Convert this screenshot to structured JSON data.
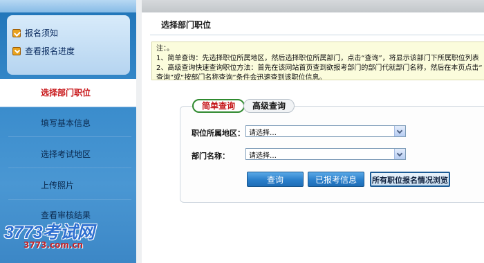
{
  "sidebar": {
    "top_links": [
      {
        "label": "报名须知",
        "icon": "check-icon"
      },
      {
        "label": "查看报名进度",
        "icon": "download-icon"
      }
    ],
    "nav_items": [
      {
        "label": "选择部门职位",
        "active": true
      },
      {
        "label": "填写基本信息",
        "active": false
      },
      {
        "label": "选择考试地区",
        "active": false
      },
      {
        "label": "上传照片",
        "active": false
      },
      {
        "label": "查看审核结果",
        "active": false
      }
    ]
  },
  "watermark": {
    "logo_text": "3773考试网",
    "url": "3773.com.cn"
  },
  "main": {
    "title": "选择部门职位",
    "notice_lines": [
      "注：。",
      "1、简单查询：先选择职位所属地区，然后选择职位所属部门，点击“查询”，将显示该部门下所属职位列表",
      "2、高级查询快速查询职位方法：首先在该网站首页查到欲报考部门的部门代就部门名称，然后在本页点击“",
      "查询”或“按部门名称查询”条件会迅速查到该职位信息。"
    ],
    "tabs": [
      {
        "label": "简单查询",
        "active": true
      },
      {
        "label": "高级查询",
        "active": false
      }
    ],
    "fields": [
      {
        "label": "职位所属地区：",
        "value": "请选择…"
      },
      {
        "label": "部门名称：",
        "value": "请选择…"
      }
    ],
    "buttons": {
      "query": "查询",
      "applied": "已报考信息",
      "browse": "所有职位报名情况浏览"
    }
  },
  "colors": {
    "sidebar_blue": "#3a8ccc",
    "active_text": "#c8171a",
    "tab_border": "#2f8a2f",
    "button_blue": "#2a7fcb"
  }
}
